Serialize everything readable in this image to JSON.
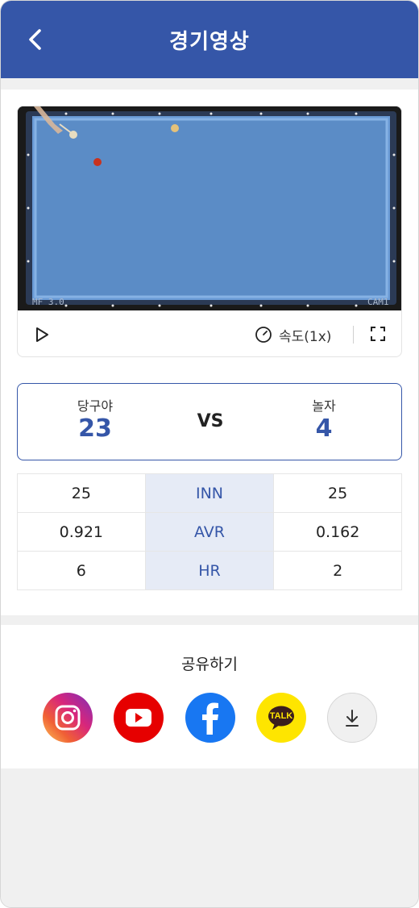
{
  "header": {
    "title": "경기영상",
    "back_icon": "chevron-left-icon"
  },
  "video": {
    "overlay_left": "MF 3.0",
    "overlay_right": "CAM1",
    "table_color": "#5b8cc6",
    "speed_label": "속도(1x)"
  },
  "match": {
    "left_player": "당구야",
    "left_score": "23",
    "vs_label": "VS",
    "right_player": "놀자",
    "right_score": "4"
  },
  "stats": [
    {
      "left": "25",
      "label": "INN",
      "right": "25"
    },
    {
      "left": "0.921",
      "label": "AVR",
      "right": "0.162"
    },
    {
      "left": "6",
      "label": "HR",
      "right": "2"
    }
  ],
  "share": {
    "title": "공유하기",
    "kakao_label": "TALK",
    "icons": [
      "instagram-icon",
      "youtube-icon",
      "facebook-icon",
      "kakaotalk-icon",
      "download-icon"
    ]
  },
  "colors": {
    "brand": "#3556a8",
    "stat_highlight": "#e6ebf6"
  }
}
